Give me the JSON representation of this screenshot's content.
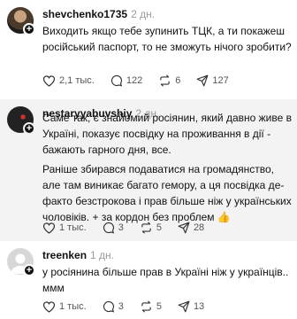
{
  "comments": [
    {
      "username": "shevchenko1735",
      "age": "2 дн.",
      "text": "Виходить якщо тебе зупинить ТЦК, а ти покажеш російський паспорт, то не зможуть нічого зробити?",
      "likes": "2,1 тыс.",
      "replies": "122",
      "reposts": "6",
      "shares": "127"
    },
    {
      "username": "nestaryyabuvshiy",
      "age": "2 дн.",
      "text": "Саме так, є знайомий росіянин, який давно живе в Україні, показує посвідку на проживання в дії - бажають гарного дня, все.",
      "text2": "Раніше збирався подаватися на громадянство, але там виникає багато гемору, а ця посвідка де-факто безстрокова і прав більше ніж у українських чоловіків. + за кордон без проблем 👍",
      "likes": "1 тыс.",
      "replies": "3",
      "reposts": "5",
      "shares": "28"
    },
    {
      "username": "treenken",
      "age": "1 дн.",
      "text": "у росіянина більше прав в Україні ніж у українців.. ммм",
      "likes": "1 тыс.",
      "replies": "3",
      "reposts": "5",
      "shares": "13"
    }
  ],
  "icons": {
    "like": "heart-icon",
    "reply": "comment-bubble-icon",
    "repost": "repost-arrows-icon",
    "share": "send-plane-icon",
    "follow": "plus-icon"
  }
}
